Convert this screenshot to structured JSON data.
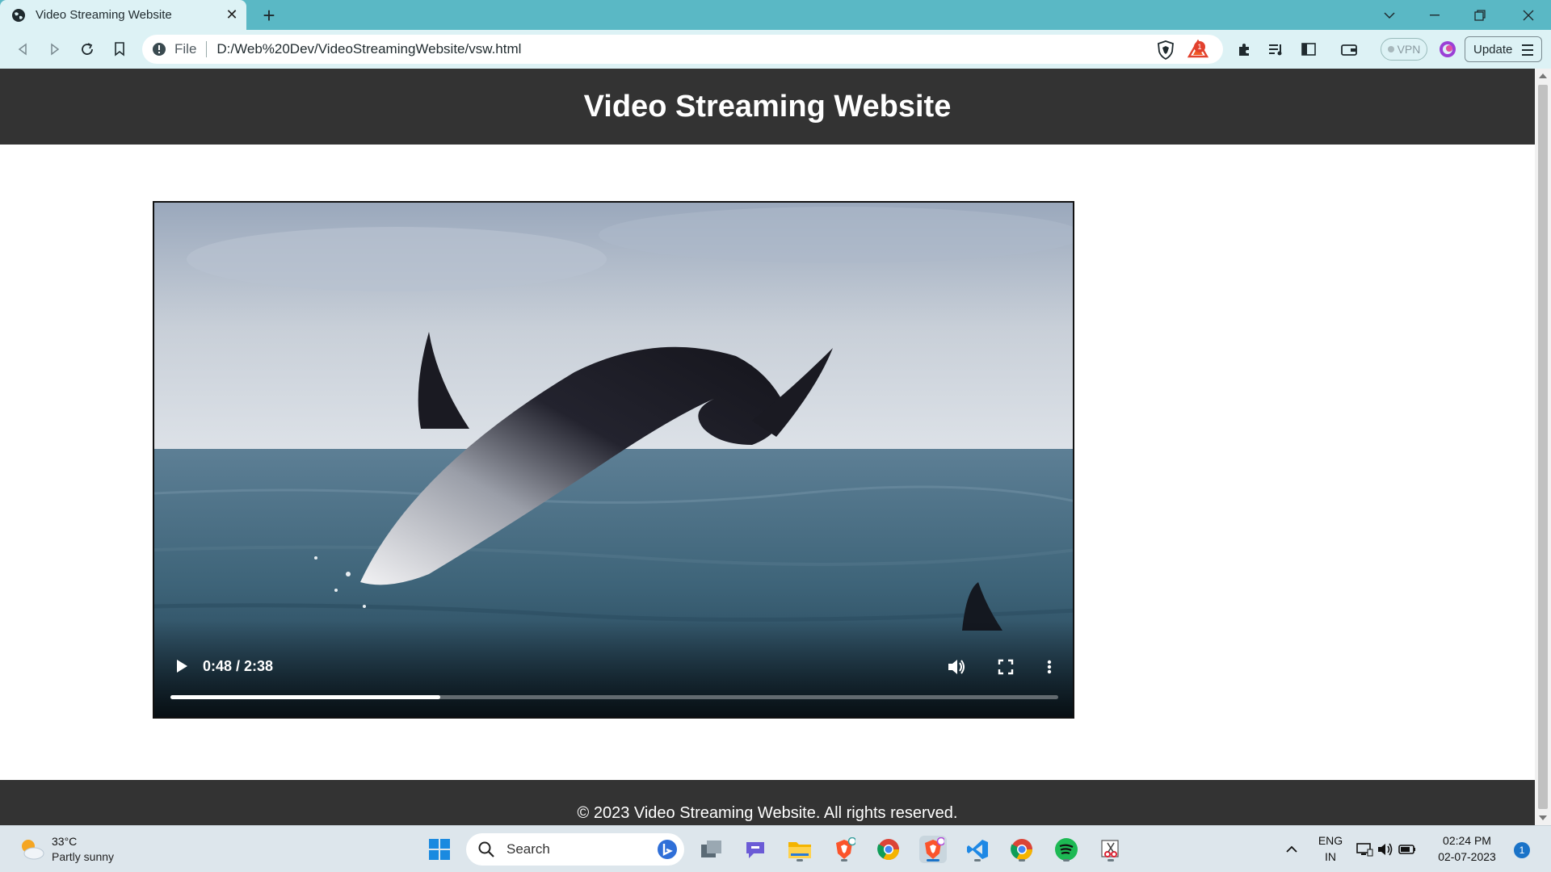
{
  "browser": {
    "tab": {
      "title": "Video Streaming Website"
    },
    "address_bar": {
      "scheme_label": "File",
      "url": "D:/Web%20Dev/VideoStreamingWebsite/vsw.html"
    },
    "rewards_badge": "1",
    "vpn_label": "VPN",
    "update_label": "Update"
  },
  "page": {
    "header_title": "Video Streaming Website",
    "video": {
      "time_display": "0:48 / 2:38",
      "progress_fraction": 0.304
    },
    "footer_text": "© 2023 Video Streaming Website. All rights reserved."
  },
  "taskbar": {
    "weather": {
      "temperature": "33°C",
      "condition": "Partly sunny"
    },
    "search_label": "Search",
    "language": {
      "line1": "ENG",
      "line2": "IN"
    },
    "clock": {
      "time": "02:24 PM",
      "date": "02-07-2023"
    },
    "notification_count": "1"
  },
  "colors": {
    "tab_strip": "#5ab8c5",
    "toolbar": "#ddf2f5",
    "site_header": "#333333",
    "taskbar": "#dde6ec"
  }
}
